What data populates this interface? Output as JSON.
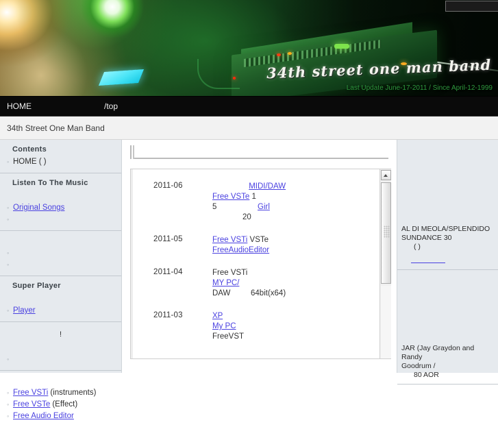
{
  "hero": {
    "logo_text": "34th street one man band",
    "update_text": "Last Update June-17-2011 / Since April-12-1999"
  },
  "nav": {
    "items": [
      {
        "label": "HOME"
      },
      {
        "label": "/top"
      }
    ]
  },
  "breadcrumb": {
    "title": "34th Street One Man Band"
  },
  "sidebar_left": {
    "blocks": [
      {
        "head": "Contents",
        "items": [
          {
            "text": "HOME (  )",
            "type": "plain"
          }
        ]
      },
      {
        "head": "Listen To The Music",
        "items": [
          {
            "text": "Original Songs",
            "type": "link"
          },
          {
            "text": "",
            "type": "link-blank"
          }
        ]
      },
      {
        "head": "",
        "items": [
          {
            "text": "",
            "type": "link-blank-w2"
          },
          {
            "text": "",
            "type": "link-blank"
          }
        ]
      },
      {
        "head": "Super Player",
        "items": [
          {
            "text": "Player",
            "type": "link"
          }
        ]
      },
      {
        "head": "",
        "center_mark": "!",
        "items": [
          {
            "text": "",
            "type": "link-blank-w3"
          }
        ]
      },
      {
        "head": "",
        "items": [
          {
            "text": "Free VSTi",
            "suffix": "(instruments)",
            "type": "link"
          },
          {
            "text": "Free VSTe",
            "suffix": "(Effect)",
            "type": "link"
          },
          {
            "text": "Free Audio Editor",
            "type": "link"
          }
        ]
      }
    ]
  },
  "main": {
    "entries": [
      {
        "date": "2011-06",
        "lines": [
          [
            {
              "t": "",
              "k": "link-blank-w3"
            },
            {
              "t": "MIDI/DAW",
              "k": "link"
            },
            {
              "t": "",
              "k": "link-blank-gap"
            }
          ],
          [
            {
              "t": "Free VSTe",
              "k": "link"
            },
            {
              "t": " 1",
              "k": "plain"
            }
          ],
          [
            {
              "t": "5 ",
              "k": "plain"
            },
            {
              "t": "",
              "k": "link-blank-w2"
            },
            {
              "t": "",
              "k": "gap"
            },
            {
              "t": "Girl",
              "k": "link"
            }
          ],
          [
            {
              "t": "20",
              "k": "plain-indent"
            }
          ]
        ]
      },
      {
        "date": "2011-05",
        "lines": [
          [
            {
              "t": "Free VSTi",
              "k": "link"
            },
            {
              "t": " VSTe",
              "k": "plain"
            }
          ],
          [
            {
              "t": "FreeAudioEditor",
              "k": "link"
            }
          ]
        ]
      },
      {
        "date": "2011-04",
        "lines": [
          [
            {
              "t": "Free VSTi",
              "k": "plain"
            }
          ],
          [
            {
              "t": "MY PC/",
              "k": "link"
            },
            {
              "t": "",
              "k": "link-blank-w2"
            },
            {
              "t": "",
              "k": "gap"
            },
            {
              "t": "",
              "k": "link-blank"
            }
          ],
          [
            {
              "t": "DAW",
              "k": "plain"
            },
            {
              "t": "",
              "k": "gap"
            },
            {
              "t": "64bit(x64)",
              "k": "plain"
            }
          ]
        ]
      },
      {
        "date": "2011-03",
        "lines": [
          [
            {
              "t": "XP",
              "k": "link"
            },
            {
              "t": "",
              "k": "link-blank-w2"
            }
          ],
          [
            {
              "t": "My PC",
              "k": "link"
            }
          ],
          [
            {
              "t": "FreeVST",
              "k": "plain"
            }
          ]
        ]
      }
    ]
  },
  "sidebar_right": {
    "blocks": [
      {
        "lines": [
          "AL DI MEOLA/SPLENDIDO",
          "SUNDANCE  30"
        ],
        "sub": "(  )",
        "has_link": true
      },
      {
        "lines": [
          "JAR (Jay Graydon and Randy",
          "Goodrum /"
        ],
        "sub": "80    AOR",
        "has_link": false
      }
    ]
  },
  "colors": {
    "link": "#4a41e0",
    "nav_bg": "#0a0a0a",
    "sidebar_bg": "#e6eaee",
    "breadcrumb_bg": "#f2f2f2",
    "update_text": "#2f9a3f"
  }
}
